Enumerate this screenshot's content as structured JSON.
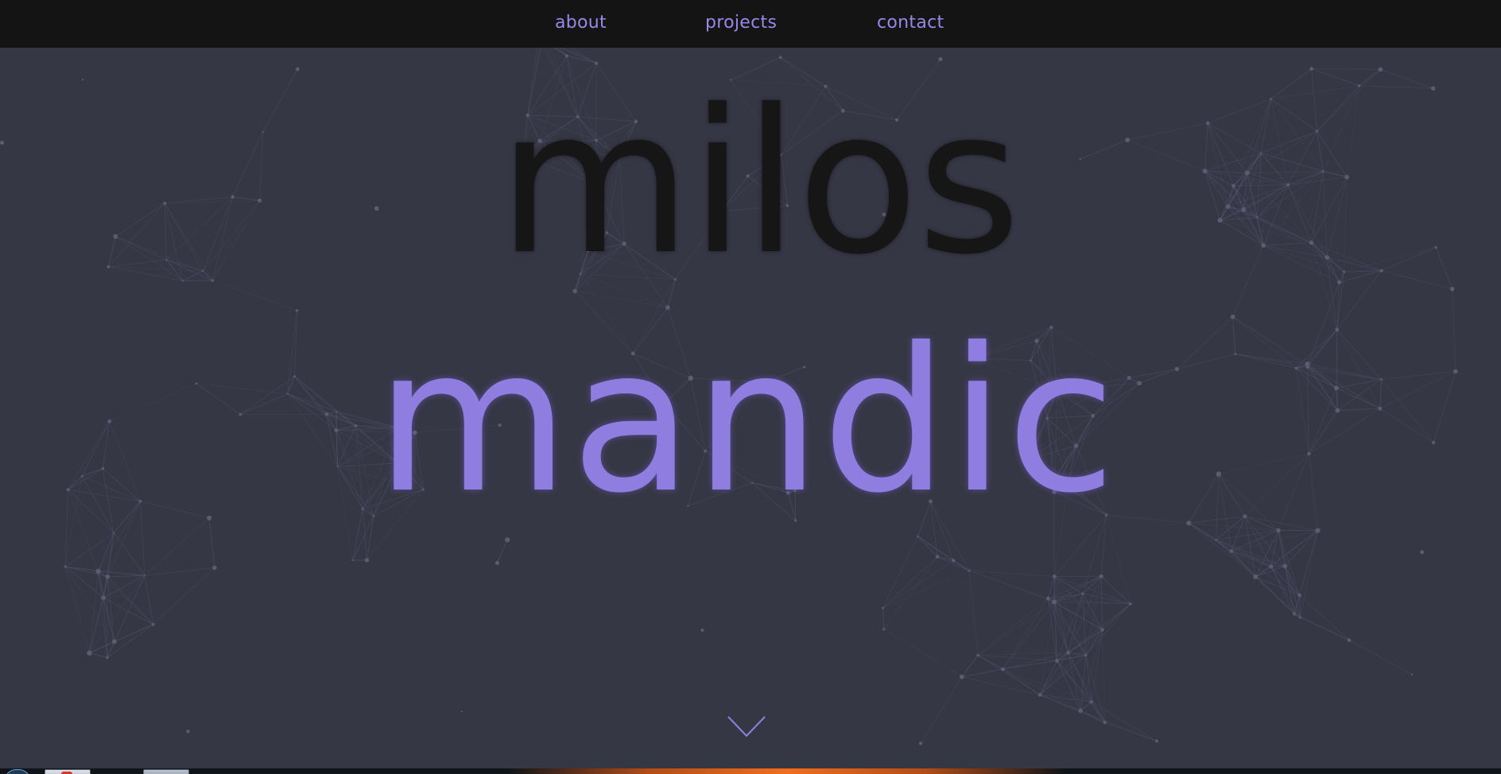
{
  "nav": {
    "items": [
      {
        "label": "about"
      },
      {
        "label": "projects"
      },
      {
        "label": "contact"
      }
    ]
  },
  "hero": {
    "first_name": "milos",
    "last_name": "mandic"
  },
  "scroll_icon": "chevron-down-icon",
  "colors": {
    "background": "#363745",
    "navbar": "#141414",
    "accent": "#8f7edf",
    "first_name": "#161616"
  }
}
